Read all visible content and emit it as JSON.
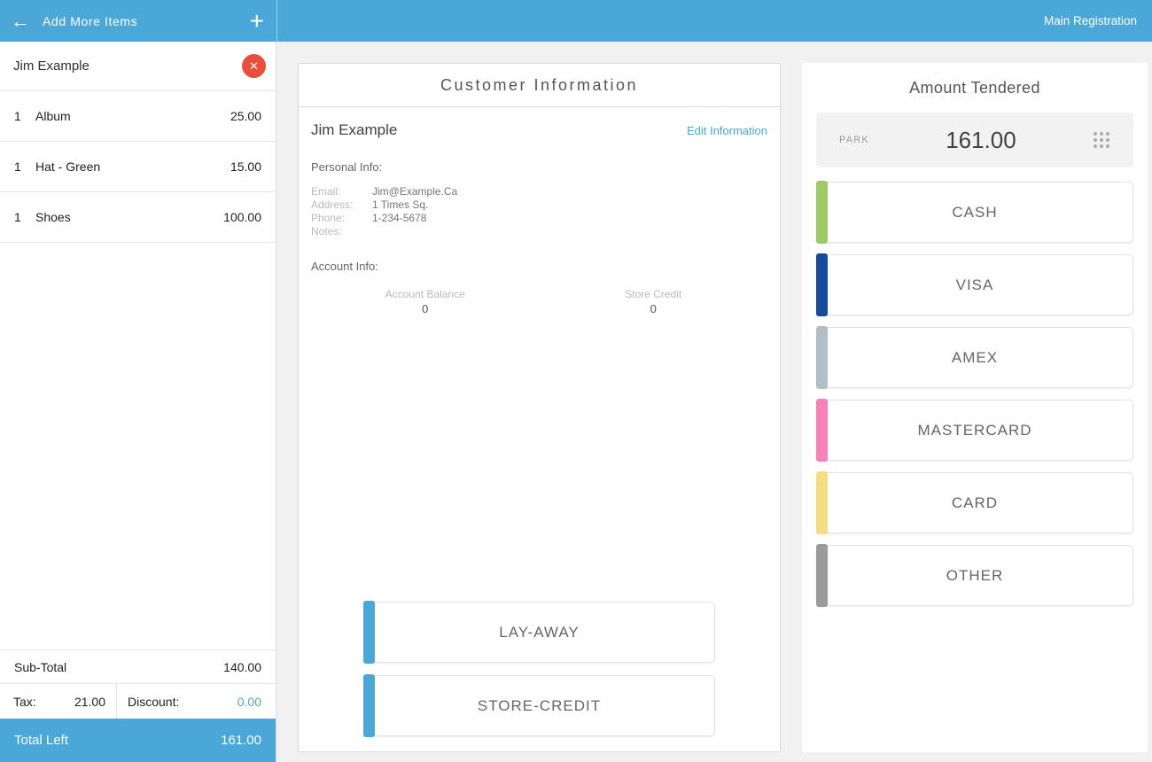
{
  "colors": {
    "primary_blue": "#4BA7D8",
    "remove_red": "#E8503C"
  },
  "topbar": {
    "add_items_label": "Add More Items",
    "register_label": "Main Registration"
  },
  "cart": {
    "customer_name": "Jim Example",
    "items": [
      {
        "qty": "1",
        "name": "Album",
        "price": "25.00"
      },
      {
        "qty": "1",
        "name": "Hat - Green",
        "price": "15.00"
      },
      {
        "qty": "1",
        "name": "Shoes",
        "price": "100.00"
      }
    ],
    "subtotal_label": "Sub-Total",
    "subtotal_value": "140.00",
    "tax_label": "Tax:",
    "tax_value": "21.00",
    "discount_label": "Discount:",
    "discount_value": "0.00",
    "total_label": "Total Left",
    "total_value": "161.00"
  },
  "customer": {
    "title": "Customer Information",
    "name": "Jim Example",
    "edit_link": "Edit Information",
    "personal_section": "Personal Info:",
    "fields": [
      {
        "label": "Email:",
        "value": "Jim@Example.Ca"
      },
      {
        "label": "Address:",
        "value": "1 Times Sq."
      },
      {
        "label": "Phone:",
        "value": "1-234-5678"
      },
      {
        "label": "Notes:",
        "value": ""
      }
    ],
    "account_section": "Account Info:",
    "account_balance_label": "Account Balance",
    "account_balance_value": "0",
    "store_credit_label": "Store Credit",
    "store_credit_value": "0",
    "accent": "#4BA7D8",
    "layaway_label": "LAY-AWAY",
    "store_credit_button_label": "STORE-CREDIT"
  },
  "tender": {
    "title": "Amount Tendered",
    "park_label": "PARK",
    "amount": "161.00",
    "methods": [
      {
        "label": "CASH",
        "accent": "#9CCB67"
      },
      {
        "label": "VISA",
        "accent": "#18499A"
      },
      {
        "label": "AMEX",
        "accent": "#B4BEC6"
      },
      {
        "label": "MASTERCARD",
        "accent": "#F782B8"
      },
      {
        "label": "CARD",
        "accent": "#F4DC81"
      },
      {
        "label": "OTHER",
        "accent": "#9B9B9B"
      }
    ]
  }
}
